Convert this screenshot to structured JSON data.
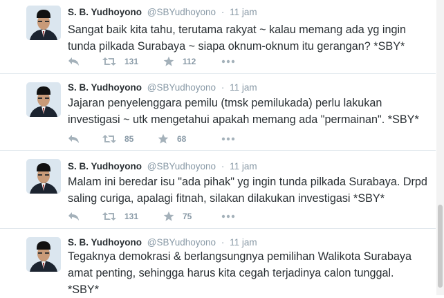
{
  "tweets": [
    {
      "name": "S. B. Yudhoyono",
      "handle": "@SBYudhoyono",
      "separator": "·",
      "time": "11 jam",
      "text": "Sangat baik kita tahu, terutama rakyat ~ kalau memang ada yg ingin tunda pilkada Surabaya ~ siapa oknum-oknum itu gerangan? *SBY*",
      "retweets": "131",
      "likes": "112"
    },
    {
      "name": "S. B. Yudhoyono",
      "handle": "@SBYudhoyono",
      "separator": "·",
      "time": "11 jam",
      "text": "Jajaran penyelenggara pemilu (tmsk pemilukada) perlu lakukan investigasi ~ utk mengetahui apakah memang ada \"permainan\". *SBY*",
      "retweets": "85",
      "likes": "68"
    },
    {
      "name": "S. B. Yudhoyono",
      "handle": "@SBYudhoyono",
      "separator": "·",
      "time": "11 jam",
      "text": "Malam ini beredar isu \"ada pihak\" yg ingin tunda pilkada Surabaya. Drpd saling curiga, apalagi fitnah, silakan dilakukan investigasi *SBY*",
      "retweets": "131",
      "likes": "75"
    },
    {
      "name": "S. B. Yudhoyono",
      "handle": "@SBYudhoyono",
      "separator": "·",
      "time": "11 jam",
      "text": "Tegaknya demokrasi & berlangsungnya pemilihan Walikota Surabaya amat penting, sehingga harus kita cegah terjadinya calon tunggal. *SBY*",
      "retweets": "",
      "likes": ""
    }
  ],
  "icons": {
    "avatar": "avatar-portrait",
    "reply": "reply-icon",
    "retweet": "retweet-icon",
    "like": "star-icon",
    "more": "more-icon"
  },
  "colors": {
    "text": "#292f33",
    "meta": "#8899a6",
    "icon": "#a4b1ba",
    "divider": "#e1e8ed"
  }
}
